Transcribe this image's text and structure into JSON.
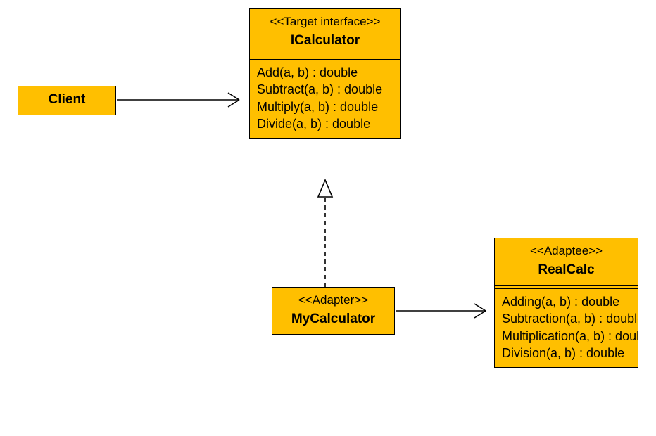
{
  "classes": {
    "client": {
      "name": "Client"
    },
    "icalculator": {
      "stereotype": "<<Target interface>>",
      "name": "ICalculator",
      "methods": [
        "Add(a, b) : double",
        "Subtract(a, b) : double",
        "Multiply(a, b) : double",
        "Divide(a, b) : double"
      ]
    },
    "mycalculator": {
      "stereotype": "<<Adapter>>",
      "name": "MyCalculator"
    },
    "realcalc": {
      "stereotype": "<<Adaptee>>",
      "name": "RealCalc",
      "methods": [
        "Adding(a, b) : double",
        "Subtraction(a, b) : double",
        "Multiplication(a, b) : double",
        "Division(a, b) : double"
      ]
    }
  },
  "relationships": [
    {
      "from": "Client",
      "to": "ICalculator",
      "type": "association-arrow"
    },
    {
      "from": "MyCalculator",
      "to": "ICalculator",
      "type": "realization-dashed-triangle"
    },
    {
      "from": "MyCalculator",
      "to": "RealCalc",
      "type": "association-arrow"
    }
  ]
}
